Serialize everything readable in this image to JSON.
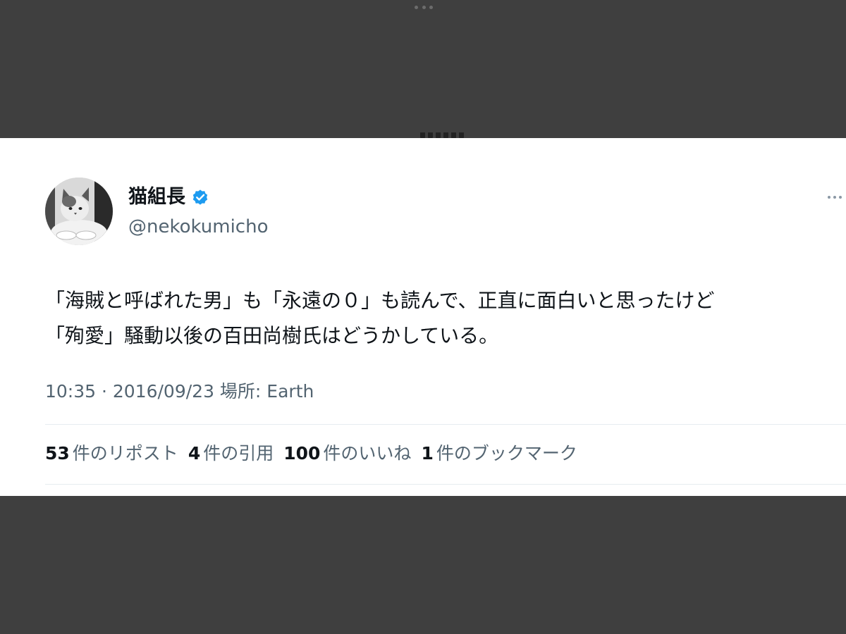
{
  "tweet": {
    "display_name": "猫組長",
    "handle": "@nekokumicho",
    "text": "「海賊と呼ばれた男」も「永遠の０」も読んで、正直に面白いと思ったけど\n「殉愛」騒動以後の百田尚樹氏はどうかしている。",
    "meta": "10:35 · 2016/09/23 場所: Earth",
    "verified": true,
    "colors": {
      "verified_badge": "#1d9bf0",
      "text": "#0f1419",
      "secondary_text": "#536471",
      "background": "#ffffff",
      "outer_background": "#3f3f3f"
    }
  },
  "stats": [
    {
      "value": "53",
      "label": "件のリポスト"
    },
    {
      "value": "4",
      "label": "件の引用"
    },
    {
      "value": "100",
      "label": "件のいいね"
    },
    {
      "value": "1",
      "label": "件のブックマーク"
    }
  ],
  "icons": {
    "verified": "verified-badge-icon",
    "more": "more-options-icon",
    "handle_dots": "drag-handle-dots-icon"
  }
}
